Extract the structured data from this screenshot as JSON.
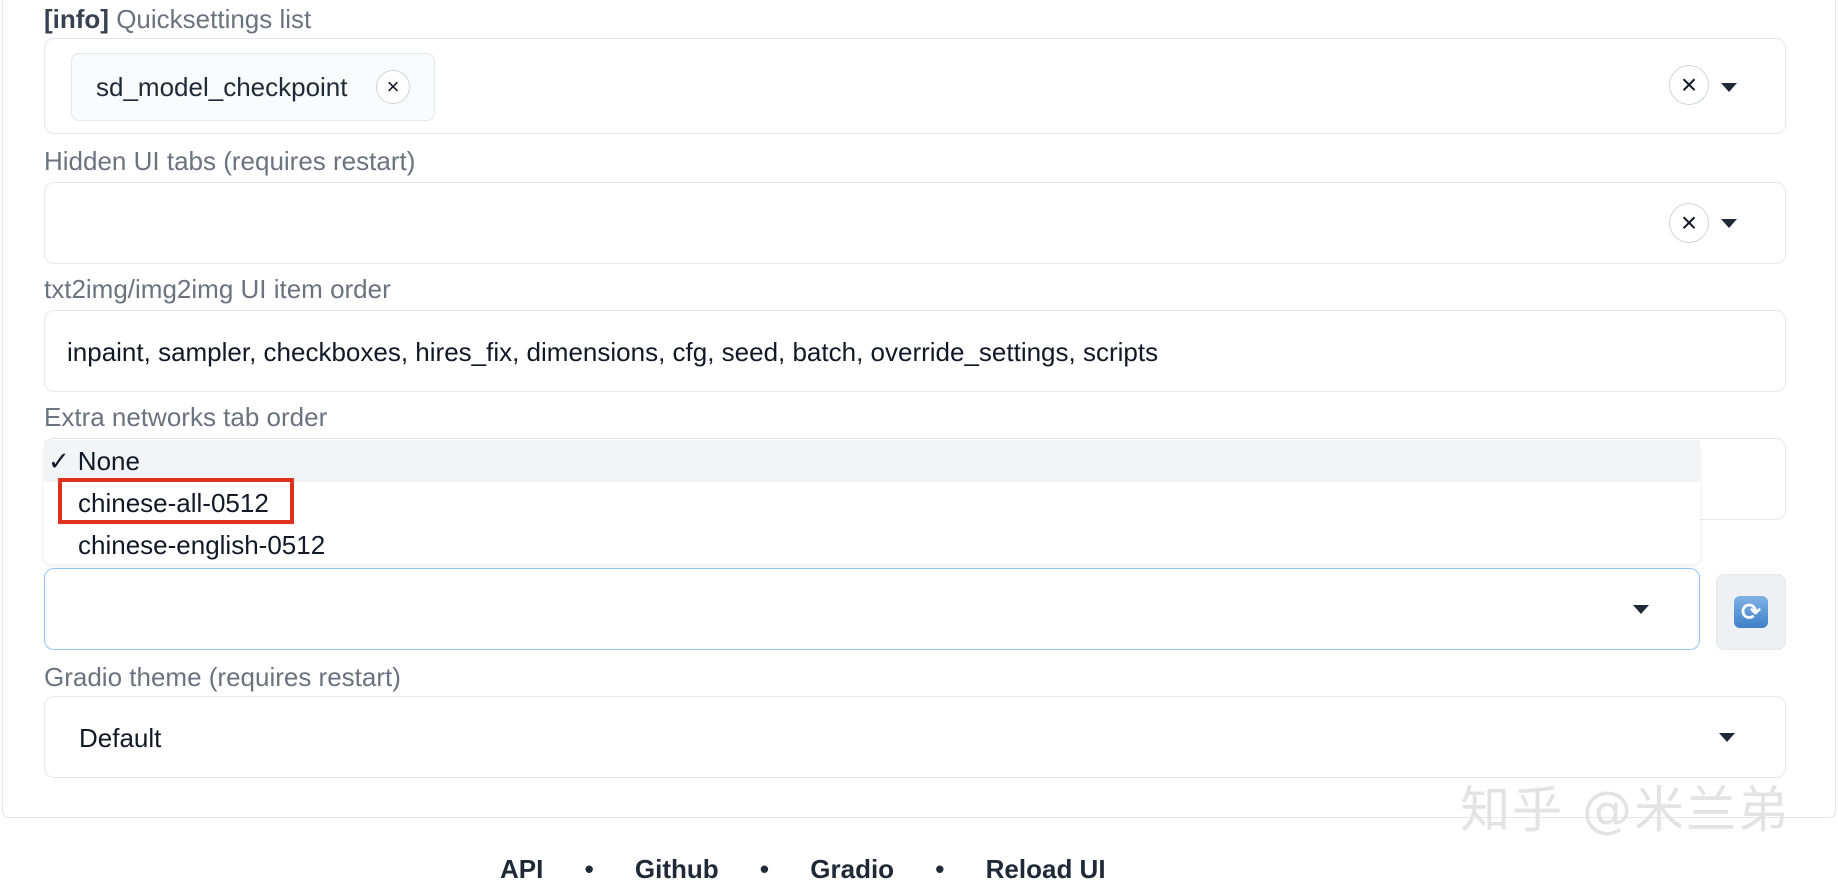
{
  "quicksettings": {
    "label_tag": "[info]",
    "label": "Quicksettings list",
    "chip": "sd_model_checkpoint",
    "chip_remove": "×",
    "clear": "×"
  },
  "hidden_tabs": {
    "label": "Hidden UI tabs (requires restart)",
    "clear": "×"
  },
  "item_order": {
    "label": "txt2img/img2img UI item order",
    "value": "inpaint, sampler, checkboxes, hires_fix, dimensions, cfg, seed, batch, override_settings, scripts"
  },
  "extra_networks": {
    "label": "Extra networks tab order"
  },
  "localization_dropdown": {
    "options": [
      {
        "check": "✓",
        "label": "None",
        "selected": true
      },
      {
        "label": "chinese-all-0512",
        "highlighted": true
      },
      {
        "label": "chinese-english-0512"
      }
    ],
    "refresh_icon": "refresh-icon"
  },
  "gradio_theme": {
    "label": "Gradio theme (requires restart)",
    "value": "Default"
  },
  "watermark": "知乎 @米兰弟",
  "footer": {
    "links": [
      "API",
      "Github",
      "Gradio",
      "Reload UI"
    ],
    "separator": "•"
  },
  "colors": {
    "highlight": "#e0311f",
    "focus_border": "#93c5fd"
  }
}
